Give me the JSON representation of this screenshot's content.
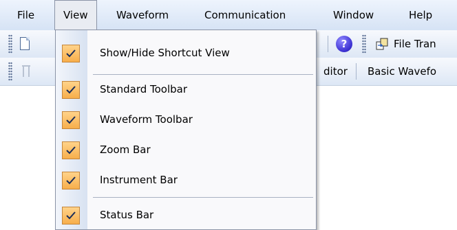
{
  "menubar": {
    "items": [
      "File",
      "View",
      "Waveform",
      "Communication",
      "Window",
      "Help"
    ],
    "open_item": "View"
  },
  "toolbar1": {
    "new_icon": "new-document-icon",
    "help_icon": "help-icon",
    "help_glyph": "?",
    "transfer_icon": "file-transfer-icon",
    "transfer_label": "File Tran"
  },
  "toolbar2": {
    "disabled_tool_icon": "pin-tool-icon",
    "editor_label": "ditor",
    "basic_waveform_label": "Basic Wavefo"
  },
  "view_menu": {
    "items": [
      {
        "label": "Show/Hide Shortcut View",
        "checked": true
      },
      {
        "label": "Standard Toolbar",
        "checked": true
      },
      {
        "label": "Waveform Toolbar",
        "checked": true
      },
      {
        "label": "Zoom Bar",
        "checked": true
      },
      {
        "label": "Instrument Bar",
        "checked": true
      },
      {
        "label": "Status Bar",
        "checked": true
      }
    ],
    "check_icon": "checkmark-icon",
    "colors": {
      "check_fill": "#f7ae4b",
      "check_border": "#c4853a"
    }
  }
}
